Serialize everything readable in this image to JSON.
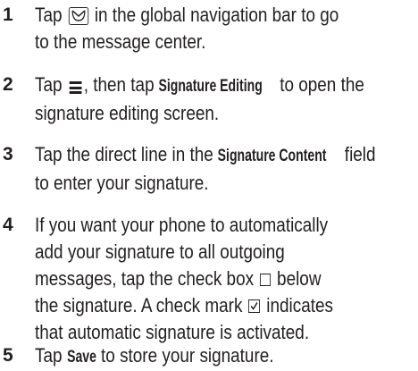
{
  "steps": [
    {
      "num": "1",
      "parts": [
        "Tap ",
        " in the global navigation bar to go",
        "to the message center."
      ]
    },
    {
      "num": "2",
      "parts": [
        "Tap ",
        ", then tap ",
        "Signature Editing",
        " to open the",
        "signature editing screen."
      ]
    },
    {
      "num": "3",
      "parts": [
        "Tap the direct line in the ",
        "Signature Content",
        " field",
        "to enter your signature."
      ]
    },
    {
      "num": "4",
      "lines": [
        "If you want your phone to automatically",
        "add your signature to all outgoing",
        "messages, tap the check box ",
        " below",
        "the signature. A check mark ",
        " indicates",
        "that automatic signature is activated."
      ]
    },
    {
      "num": "5",
      "parts": [
        "Tap ",
        "Save",
        " to store your signature."
      ]
    }
  ],
  "icons": {
    "message_center": "envelope-icon",
    "menu": "menu-icon",
    "checkbox": "checkbox-unchecked-icon",
    "checkmark": "checkbox-checked-icon"
  }
}
